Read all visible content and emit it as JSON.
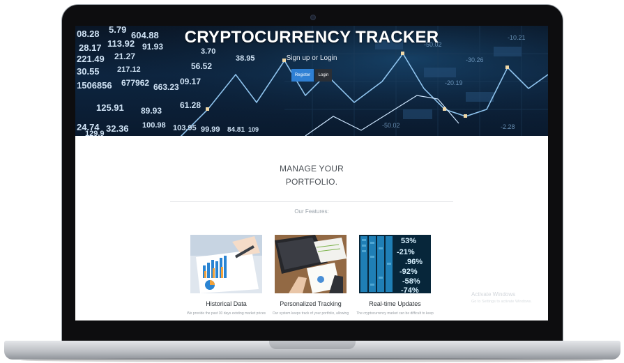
{
  "hero": {
    "title": "CRYPTOCURRENCY TRACKER",
    "subtitle": "Sign up or Login",
    "register_label": "Register",
    "login_label": "Login",
    "ticker_numbers": [
      "08.28",
      "5.79",
      "604.88",
      "28.17",
      "113.92",
      "91.93",
      "221.49",
      "21.27",
      "30.55",
      "217.12",
      "1506856",
      "677962",
      "663.23",
      "30.55",
      "125.91",
      "89.93",
      "24.74",
      "32.36",
      "103.95",
      "100.98",
      "103.95",
      "99.99",
      "129.9",
      "84.81",
      "109",
      "56.52",
      "09.17",
      "38.95",
      "3.70",
      "61.28"
    ]
  },
  "main": {
    "heading_line1": "MANAGE YOUR",
    "heading_line2": "PORTFOLIO.",
    "features_label": "Our Features:"
  },
  "features": [
    {
      "title": "Historical Data",
      "desc": "We provide the past 30 days existing market prices",
      "icon": "chart-report-image"
    },
    {
      "title": "Personalized Tracking",
      "desc": "Our system keeps track of your portfolio, allowing",
      "icon": "laptop-desk-image"
    },
    {
      "title": "Real-time Updates",
      "desc": "The cryptocurrency market can be difficult to keep",
      "icon": "stock-board-image"
    }
  ],
  "watermark": {
    "title": "Activate Windows",
    "subtitle": "Go to Settings to activate Windows."
  },
  "colors": {
    "register_button": "#2f80d4",
    "login_button": "#2a2f36",
    "hero_background": "#0d2540"
  }
}
